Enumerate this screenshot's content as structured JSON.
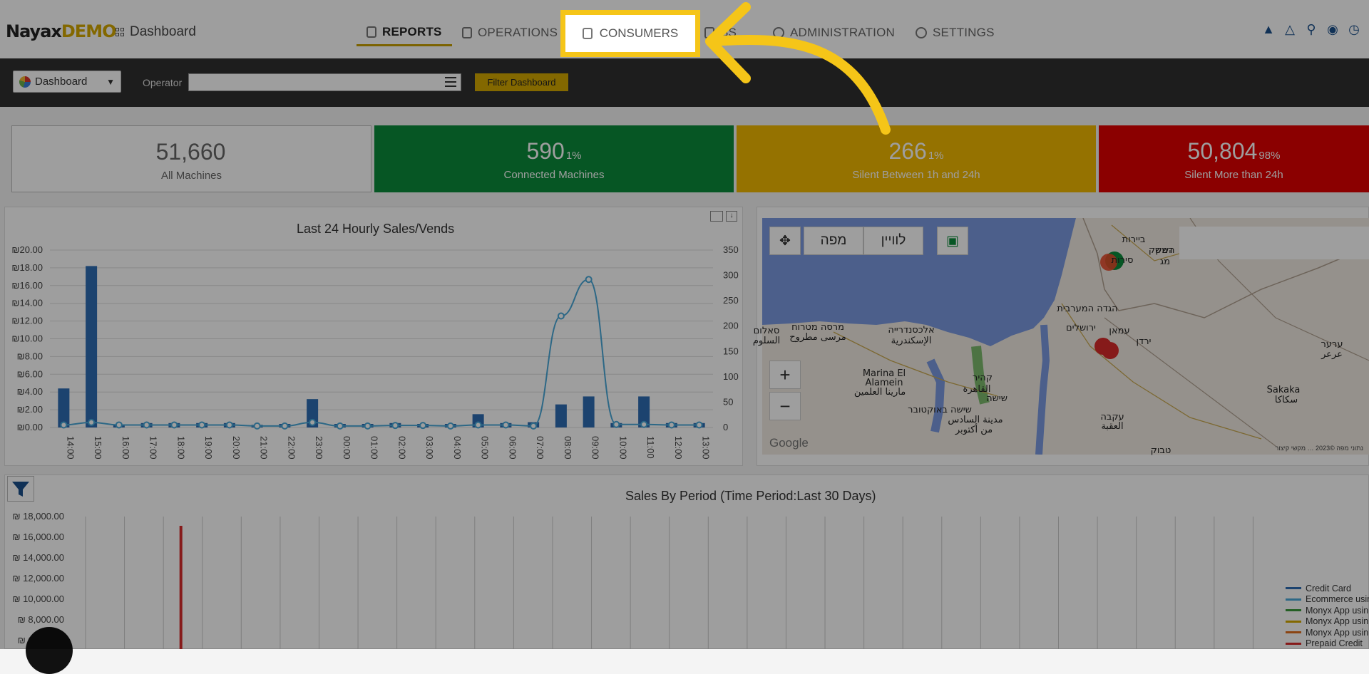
{
  "header": {
    "logo_main": "Nayax",
    "logo_suffix": "DEMO",
    "breadcrumb": "Dashboard",
    "nav": [
      {
        "label": "REPORTS",
        "active": true
      },
      {
        "label": "OPERATIONS",
        "active": false
      },
      {
        "label": "CONSUMERS",
        "active": false
      },
      {
        "label": "SS",
        "active": false
      },
      {
        "label": "ADMINISTRATION",
        "active": false
      },
      {
        "label": "SETTINGS",
        "active": false
      }
    ],
    "right_icons": [
      "graduation-cap-icon",
      "flask-icon",
      "search-icon",
      "globe-icon",
      "clock-icon"
    ]
  },
  "filterbar": {
    "dashboard_select": "Dashboard",
    "operator_label": "Operator",
    "operator_value": "",
    "filter_button": "Filter Dashboard"
  },
  "cards": [
    {
      "value": "51,660",
      "pct": "",
      "label": "All Machines",
      "color": "#ffffff"
    },
    {
      "value": "590",
      "pct": "1%",
      "label": "Connected Machines",
      "color": "#0b8c3a"
    },
    {
      "value": "266",
      "pct": "1%",
      "label": "Silent Between 1h and 24h",
      "color": "#f1b800"
    },
    {
      "value": "50,804",
      "pct": "98%",
      "label": "Silent More than 24h",
      "color": "#e00000"
    }
  ],
  "map": {
    "layer_labels": [
      "מפה",
      "לוויין"
    ],
    "zoom_in": "+",
    "zoom_out": "−",
    "google": "Google",
    "attribution": "נתוני מפה ©2023 … מקשי קיצור",
    "places": [
      {
        "text": "ביירות",
        "x": 1590,
        "y": 329
      },
      {
        "text": "סירות",
        "x": 1574,
        "y": 358
      },
      {
        "text": "דמשק",
        "x": 1628,
        "y": 344
      },
      {
        "text": "הגדה המערבית",
        "x": 1525,
        "y": 426
      },
      {
        "text": "ירושלים",
        "x": 1516,
        "y": 453
      },
      {
        "text": "עמאן",
        "x": 1570,
        "y": 457
      },
      {
        "text": "ירדן",
        "x": 1604,
        "y": 472
      },
      {
        "text": "מרסה מטרוח",
        "x": 1147,
        "y": 452
      },
      {
        "text": "مرسى مطروح",
        "x": 1147,
        "y": 466
      },
      {
        "text": "סאלום",
        "x": 1075,
        "y": 457
      },
      {
        "text": "السلوم",
        "x": 1075,
        "y": 471
      },
      {
        "text": "אלכסנדרייה",
        "x": 1278,
        "y": 456
      },
      {
        "text": "الإسكندرية",
        "x": 1278,
        "y": 471
      },
      {
        "text": "Marina El",
        "x": 1240,
        "y": 517
      },
      {
        "text": "Alamein",
        "x": 1240,
        "y": 530
      },
      {
        "text": "مارينا العلمين",
        "x": 1234,
        "y": 543
      },
      {
        "text": "קהיר",
        "x": 1378,
        "y": 523
      },
      {
        "text": "القاهرة",
        "x": 1370,
        "y": 539
      },
      {
        "text": "שישה באוקטובר",
        "x": 1318,
        "y": 568
      },
      {
        "text": "שישה",
        "x": 1398,
        "y": 552
      },
      {
        "text": "مدينة السادس",
        "x": 1368,
        "y": 582
      },
      {
        "text": "من أكتوبر",
        "x": 1366,
        "y": 596
      },
      {
        "text": "עקבה",
        "x": 1560,
        "y": 578
      },
      {
        "text": "العقبة",
        "x": 1560,
        "y": 591
      },
      {
        "text": "טבוק",
        "x": 1628,
        "y": 625
      },
      {
        "text": "Sakaka",
        "x": 1800,
        "y": 540
      },
      {
        "text": "سكاكا",
        "x": 1804,
        "y": 554
      },
      {
        "text": "ערער",
        "x": 1868,
        "y": 476
      },
      {
        "text": "عرعر",
        "x": 1868,
        "y": 490
      },
      {
        "text": "השק",
        "x": 1634,
        "y": 344
      },
      {
        "text": "מג",
        "x": 1634,
        "y": 360
      }
    ]
  },
  "chart_data": [
    {
      "type": "bar",
      "title": "Last 24 Hourly Sales/Vends",
      "categories": [
        "14:00",
        "15:00",
        "16:00",
        "17:00",
        "18:00",
        "19:00",
        "20:00",
        "21:00",
        "22:00",
        "23:00",
        "00:00",
        "01:00",
        "02:00",
        "03:00",
        "04:00",
        "05:00",
        "06:00",
        "07:00",
        "08:00",
        "09:00",
        "10:00",
        "11:00",
        "12:00",
        "13:00"
      ],
      "y_ticks": [
        "₪0.00",
        "₪2.00",
        "₪4.00",
        "₪6.00",
        "₪8.00",
        "₪10.00",
        "₪12.00",
        "₪14.00",
        "₪16.00",
        "₪18.00",
        "₪20.00"
      ],
      "y2_ticks": [
        "0",
        "50",
        "100",
        "150",
        "200",
        "250",
        "300",
        "350"
      ],
      "ylim": [
        0,
        20
      ],
      "y2lim": [
        0,
        350
      ],
      "series": [
        {
          "kind": "bar",
          "color": "#2e6db4",
          "values": [
            4.4,
            18.2,
            0.3,
            0.5,
            0.5,
            0.5,
            0.5,
            0.3,
            0.4,
            3.2,
            0.4,
            0.4,
            0.5,
            0.4,
            0.4,
            1.5,
            0.5,
            0.6,
            2.6,
            3.5,
            0.5,
            3.5,
            0.5,
            0.5
          ]
        },
        {
          "kind": "line",
          "color": "#4aa8d8",
          "values": [
            5,
            10,
            5,
            5,
            5,
            5,
            5,
            3,
            3,
            10,
            3,
            3,
            4,
            4,
            3,
            5,
            5,
            3,
            220,
            292,
            6,
            6,
            5,
            5
          ]
        }
      ]
    },
    {
      "type": "line",
      "title": "Sales By Period (Time Period:Last 30 Days)",
      "y_ticks": [
        "₪ 18,000.00",
        "₪ 16,000.00",
        "₪ 14,000.00",
        "₪ 12,000.00",
        "₪ 10,000.00",
        "₪ 8,000.00",
        "₪ 6,000.00"
      ],
      "ylim": [
        6000,
        18000
      ],
      "legend": [
        {
          "name": "Credit Card",
          "color": "#2e6db4"
        },
        {
          "name": "Ecommerce usin",
          "color": "#4aa8d8"
        },
        {
          "name": "Monyx App usin",
          "color": "#3a9a3a"
        },
        {
          "name": "Monyx App usin",
          "color": "#d4a800"
        },
        {
          "name": "Monyx App usin",
          "color": "#e07020"
        },
        {
          "name": "Prepaid Credit",
          "color": "#d82b2b"
        }
      ],
      "spike": {
        "index": 4,
        "value": 17100,
        "color": "#d82b2b"
      }
    }
  ]
}
